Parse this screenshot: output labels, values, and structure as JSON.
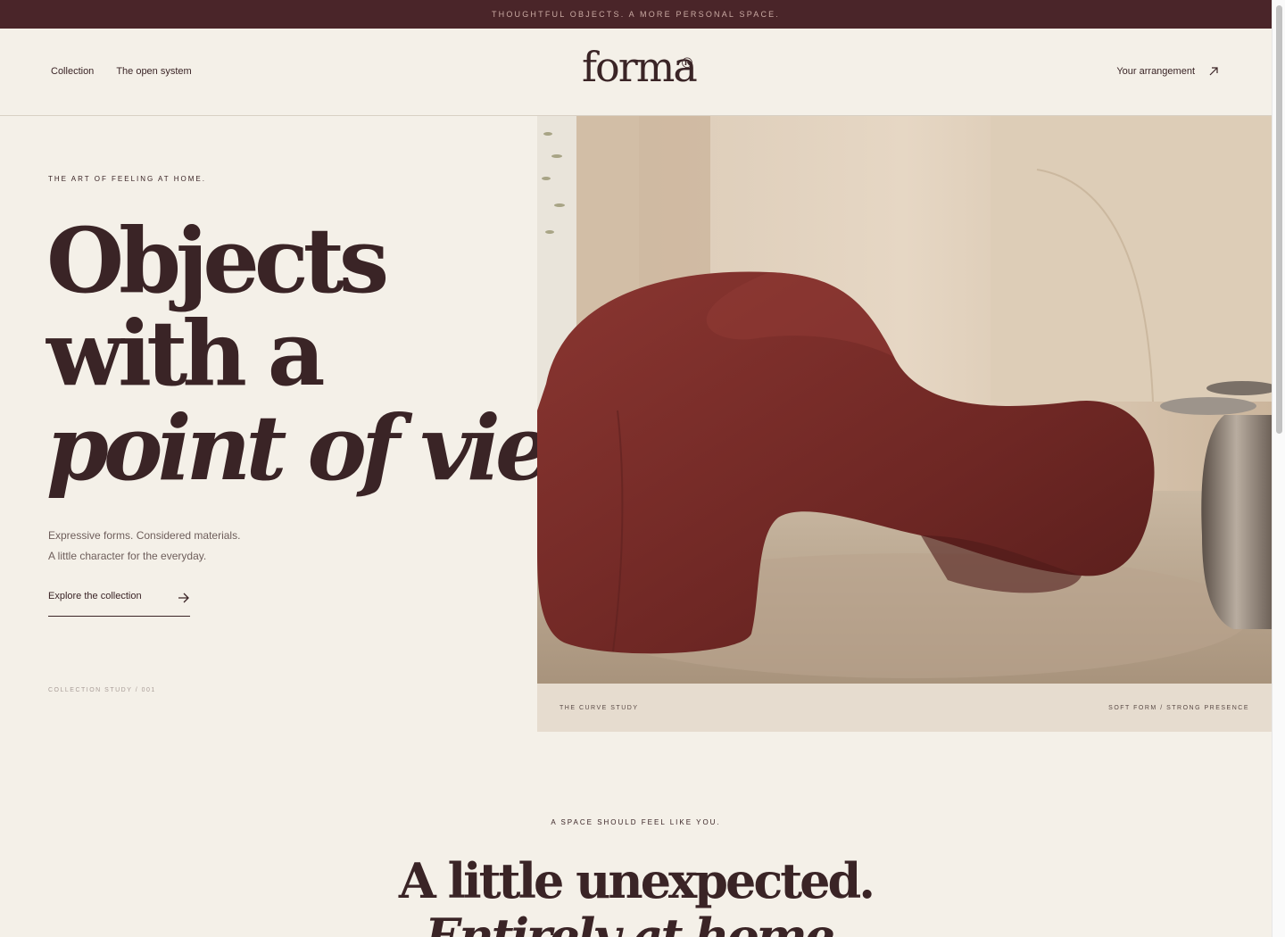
{
  "announcement": "THOUGHTFUL OBJECTS. A MORE PERSONAL SPACE.",
  "nav": {
    "left": [
      "Collection",
      "The open system"
    ],
    "logo": "forma",
    "logo_mark": "®",
    "right_label": "Your arrangement"
  },
  "hero": {
    "eyebrow": "THE ART OF FEELING AT HOME.",
    "headline_line1": "Objects",
    "headline_line2": "with a",
    "headline_line3": "point of view.",
    "sub_line1": "Expressive forms. Considered materials.",
    "sub_line2": "A little character for the everyday.",
    "cta": "Explore the collection",
    "study_code": "COLLECTION STUDY / 001",
    "caption_left": "THE CURVE STUDY",
    "caption_right": "SOFT FORM / STRONG PRESENCE"
  },
  "section2": {
    "eyebrow": "A SPACE SHOULD FEEL LIKE YOU.",
    "title_line1": "A little unexpected.",
    "title_line2": "Entirely at home."
  },
  "colors": {
    "background": "#f4f0e8",
    "announce_bg": "#4a2529",
    "ink": "#3a2426",
    "chair": "#7a2c2a"
  }
}
